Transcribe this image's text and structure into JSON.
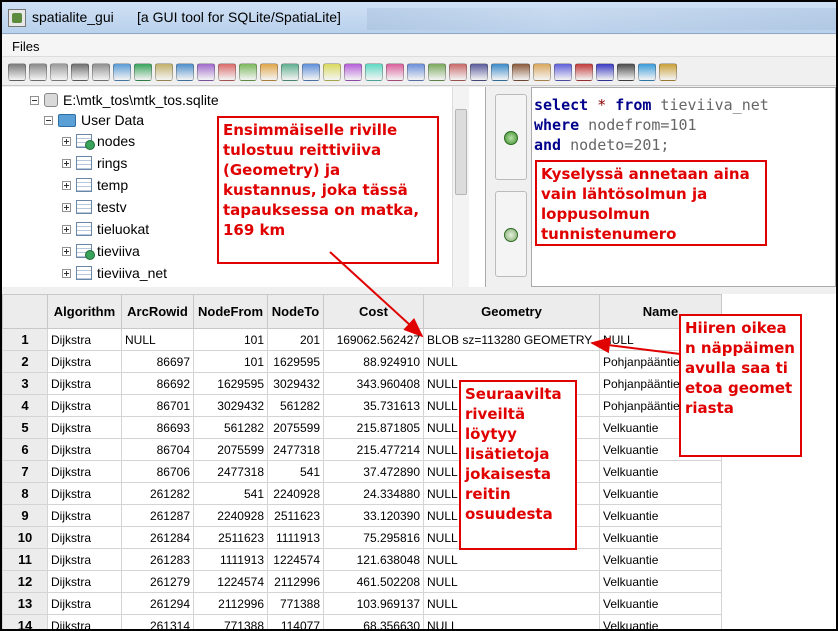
{
  "window": {
    "app_name": "spatialite_gui",
    "description": "[a GUI tool for SQLite/SpatiaLite]"
  },
  "menu": {
    "files": "Files"
  },
  "tree": {
    "root": "E:\\mtk_tos\\mtk_tos.sqlite",
    "group": "User Data",
    "items": [
      "nodes",
      "rings",
      "temp",
      "testv",
      "tieluokat",
      "tieviiva",
      "tieviiva_net"
    ]
  },
  "sql": {
    "line1": {
      "kw": "select",
      "op": "*",
      "kw2": "from",
      "rest": " tieviiva_net"
    },
    "line2": {
      "kw": "where",
      "rest": " nodefrom=101"
    },
    "line3": {
      "kw": "and",
      "rest": " nodeto=201;"
    }
  },
  "grid": {
    "columns": [
      "Algorithm",
      "ArcRowid",
      "NodeFrom",
      "NodeTo",
      "Cost",
      "Geometry",
      "Name"
    ],
    "rows": [
      [
        "1",
        "Dijkstra",
        "NULL",
        "101",
        "201",
        "169062.562427",
        "BLOB sz=113280 GEOMETRY",
        "NULL"
      ],
      [
        "2",
        "Dijkstra",
        "86697",
        "101",
        "1629595",
        "88.924910",
        "NULL",
        "Pohjanpääntie"
      ],
      [
        "3",
        "Dijkstra",
        "86692",
        "1629595",
        "3029432",
        "343.960408",
        "NULL",
        "Pohjanpääntie"
      ],
      [
        "4",
        "Dijkstra",
        "86701",
        "3029432",
        "561282",
        "35.731613",
        "NULL",
        "Pohjanpääntie"
      ],
      [
        "5",
        "Dijkstra",
        "86693",
        "561282",
        "2075599",
        "215.871805",
        "NULL",
        "Velkuantie"
      ],
      [
        "6",
        "Dijkstra",
        "86704",
        "2075599",
        "2477318",
        "215.477214",
        "NULL",
        "Velkuantie"
      ],
      [
        "7",
        "Dijkstra",
        "86706",
        "2477318",
        "541",
        "37.472890",
        "NULL",
        "Velkuantie"
      ],
      [
        "8",
        "Dijkstra",
        "261282",
        "541",
        "2240928",
        "24.334880",
        "NULL",
        "Velkuantie"
      ],
      [
        "9",
        "Dijkstra",
        "261287",
        "2240928",
        "2511623",
        "33.120390",
        "NULL",
        "Velkuantie"
      ],
      [
        "10",
        "Dijkstra",
        "261284",
        "2511623",
        "1111913",
        "75.295816",
        "NULL",
        "Velkuantie"
      ],
      [
        "11",
        "Dijkstra",
        "261283",
        "1111913",
        "1224574",
        "121.638048",
        "NULL",
        "Velkuantie"
      ],
      [
        "12",
        "Dijkstra",
        "261279",
        "1224574",
        "2112996",
        "461.502208",
        "NULL",
        "Velkuantie"
      ],
      [
        "13",
        "Dijkstra",
        "261294",
        "2112996",
        "771388",
        "103.969137",
        "NULL",
        "Velkuantie"
      ],
      [
        "14",
        "Dijkstra",
        "261314",
        "771388",
        "114077",
        "68.356630",
        "NULL",
        "Velkuantie"
      ]
    ]
  },
  "annotations": {
    "route_note": "Ensimmäiselle riville tulostuu reittiviiva (Geometry) ja kustannus, joka tässä tapauksessa on matka, 169 km",
    "query_note": "Kyselyssä annetaan aina vain lähtösolmun ja loppusolmun tunnistenumero",
    "rows_note": "Seuraavilta riveiltä löytyy lisätietoja jokaisesta reitin osuudesta",
    "mouse_note": "Hiiren oikean näppäimen avulla saa tietoa geometriasta"
  },
  "colors": {
    "annotation": "#e00000",
    "keyword": "#00008b"
  }
}
